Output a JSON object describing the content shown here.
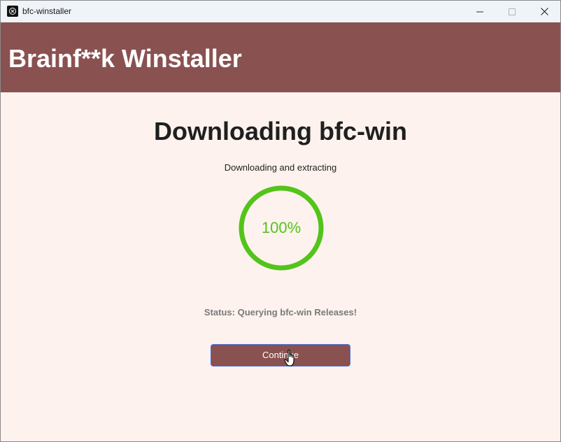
{
  "window": {
    "title": "bfc-winstaller",
    "controls": {
      "minimize": "minimize-icon",
      "maximize": "maximize-icon",
      "close": "close-icon"
    }
  },
  "header": {
    "title": "Brainf**k Winstaller",
    "background": "#8a5151"
  },
  "main": {
    "title": "Downloading bfc-win",
    "subtitle": "Downloading and extracting",
    "progress": {
      "percent": 100,
      "label": "100%",
      "color": "#52c41a"
    },
    "status": "Status: Querying bfc-win Releases!",
    "continue_label": "Continue"
  },
  "colors": {
    "accent": "#8a5151",
    "page_background": "#fdf2ed",
    "progress": "#52c41a",
    "button_border": "#4a6fd6"
  }
}
